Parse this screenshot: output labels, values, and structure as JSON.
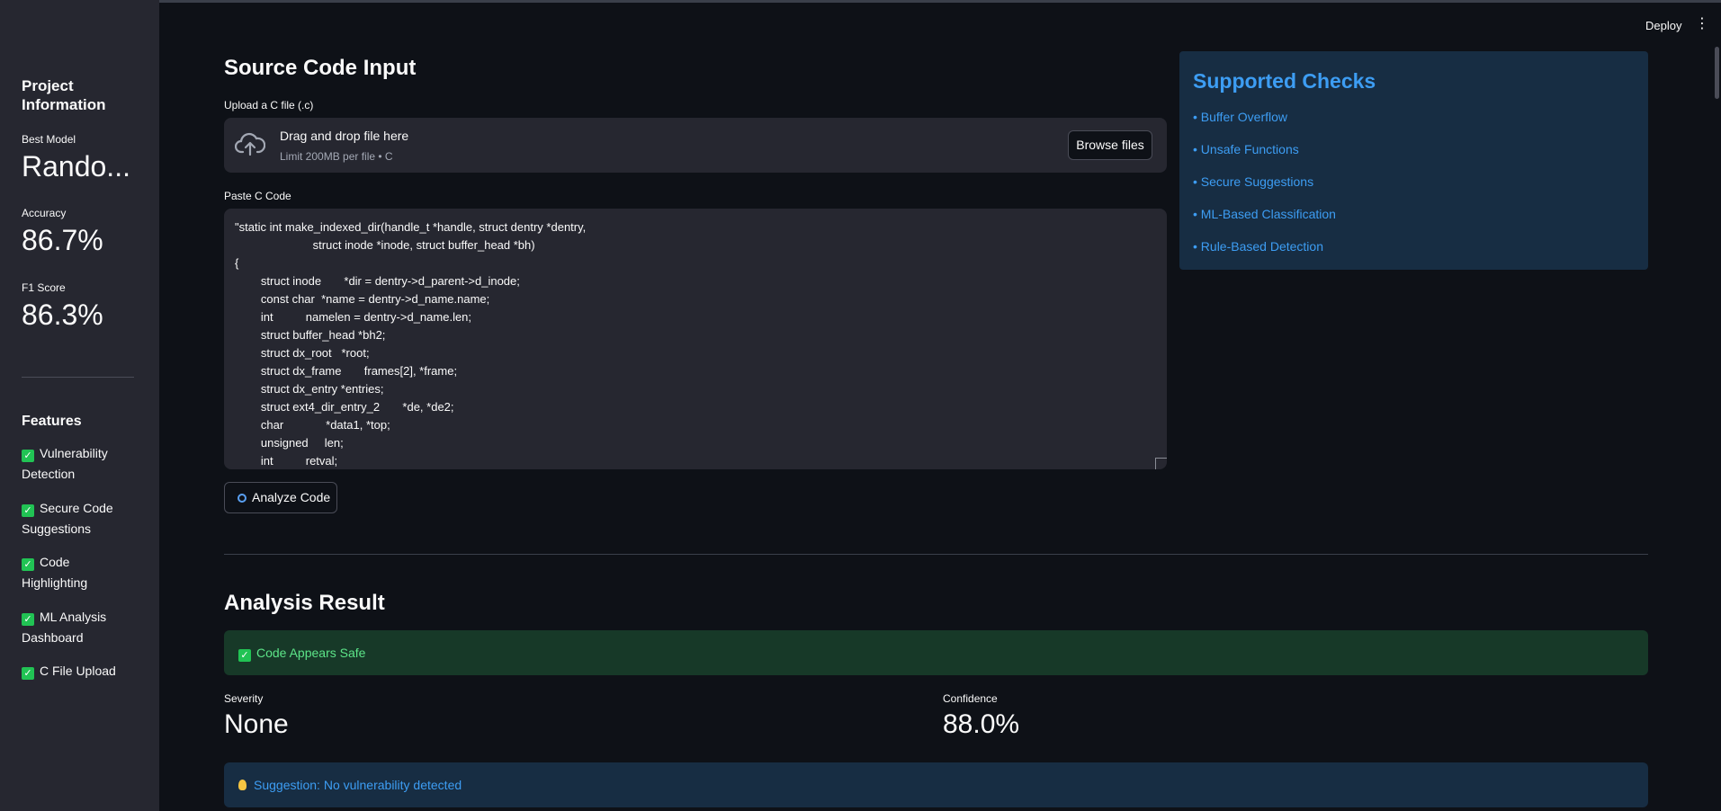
{
  "sidebar": {
    "title": "Project Information",
    "metrics": [
      {
        "label": "Best Model",
        "value": "Rando..."
      },
      {
        "label": "Accuracy",
        "value": "86.7%"
      },
      {
        "label": "F1 Score",
        "value": "86.3%"
      }
    ],
    "features_title": "Features",
    "features": [
      {
        "icon": "check-icon",
        "label": "Vulnerability Detection"
      },
      {
        "icon": "check-icon",
        "label": "Secure Code Suggestions"
      },
      {
        "icon": "check-icon",
        "label": "Code Highlighting"
      },
      {
        "icon": "check-icon",
        "label": "ML Analysis Dashboard"
      },
      {
        "icon": "check-icon",
        "label": "C File Upload"
      }
    ]
  },
  "header": {
    "deploy_label": "Deploy",
    "menu_glyph": "⋮"
  },
  "input": {
    "title": "Source Code Input",
    "upload_label": "Upload a C file (.c)",
    "drop_text": "Drag and drop file here",
    "drop_limit": "Limit 200MB per file • C",
    "browse_label": "Browse files",
    "paste_label": "Paste C Code",
    "code_lines": [
      "\"static int make_indexed_dir(handle_t *handle, struct dentry *dentry,",
      "                        struct inode *inode, struct buffer_head *bh)",
      "{",
      "        struct inode       *dir = dentry->d_parent->d_inode;",
      "        const char  *name = dentry->d_name.name;",
      "        int          namelen = dentry->d_name.len;",
      "        struct buffer_head *bh2;",
      "        struct dx_root   *root;",
      "        struct dx_frame       frames[2], *frame;",
      "        struct dx_entry *entries;",
      "        struct ext4_dir_entry_2       *de, *de2;",
      "        char             *data1, *top;",
      "        unsigned     len;",
      "        int          retval;"
    ],
    "analyze_label": "Analyze Code"
  },
  "checks": {
    "title": "Supported Checks",
    "items": [
      "• Buffer Overflow",
      "• Unsafe Functions",
      "• Secure Suggestions",
      "• ML-Based Classification",
      "• Rule-Based Detection"
    ]
  },
  "result": {
    "title": "Analysis Result",
    "status": "Code Appears Safe",
    "severity_label": "Severity",
    "severity_value": "None",
    "confidence_label": "Confidence",
    "confidence_value": "88.0%",
    "suggestion": "Suggestion: No vulnerability detected"
  },
  "colors": {
    "background": "#0e1117",
    "sidebar": "#262730",
    "success_bg": "#173928",
    "success_text": "#5ce488",
    "info_bg": "#172d43",
    "info_text": "#3d9df3",
    "check_green": "#21c354"
  }
}
